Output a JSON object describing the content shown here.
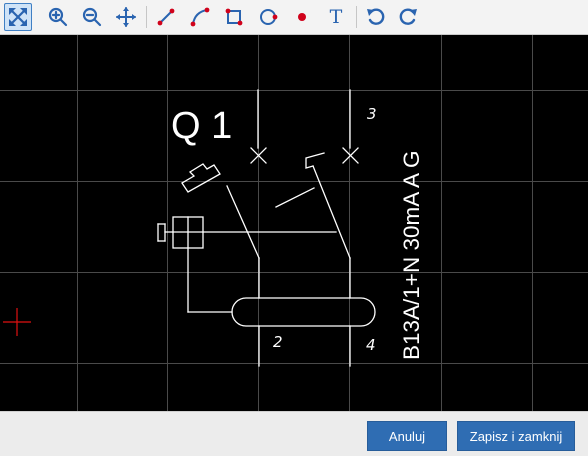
{
  "toolbar": {
    "tools": [
      {
        "id": "zoom-fit",
        "icon": "zoom-fit-icon",
        "active": true
      },
      {
        "id": "zoom-in",
        "icon": "zoom-in-icon",
        "active": false
      },
      {
        "id": "zoom-out",
        "icon": "zoom-out-icon",
        "active": false
      },
      {
        "id": "pan",
        "icon": "move-icon",
        "active": false
      },
      {
        "id": "line",
        "icon": "line-icon",
        "active": false
      },
      {
        "id": "polyline",
        "icon": "polyline-icon",
        "active": false
      },
      {
        "id": "rectangle",
        "icon": "rectangle-icon",
        "active": false
      },
      {
        "id": "circle",
        "icon": "circle-icon",
        "active": false
      },
      {
        "id": "point",
        "icon": "point-icon",
        "active": false
      },
      {
        "id": "text",
        "icon": "text-icon",
        "active": false,
        "glyph": "T"
      },
      {
        "id": "undo",
        "icon": "undo-icon",
        "active": false
      },
      {
        "id": "redo",
        "icon": "redo-icon",
        "active": false
      }
    ],
    "icon_color": "#2a64b0",
    "draw_accent": "#d0021b"
  },
  "drawing": {
    "background": "#000000",
    "grid_color": "#4a4a4a",
    "stroke_color": "#ffffff",
    "cursor_color": "#e01010",
    "label_q": "Q 1",
    "label_rating": "B13A/1+N 30mA A G",
    "terminal_top_right": "3",
    "terminal_bottom_left": "2",
    "terminal_bottom_right": "4"
  },
  "footer": {
    "cancel_label": "Anuluj",
    "save_label": "Zapisz i zamknij",
    "button_color": "#2f6db3"
  }
}
